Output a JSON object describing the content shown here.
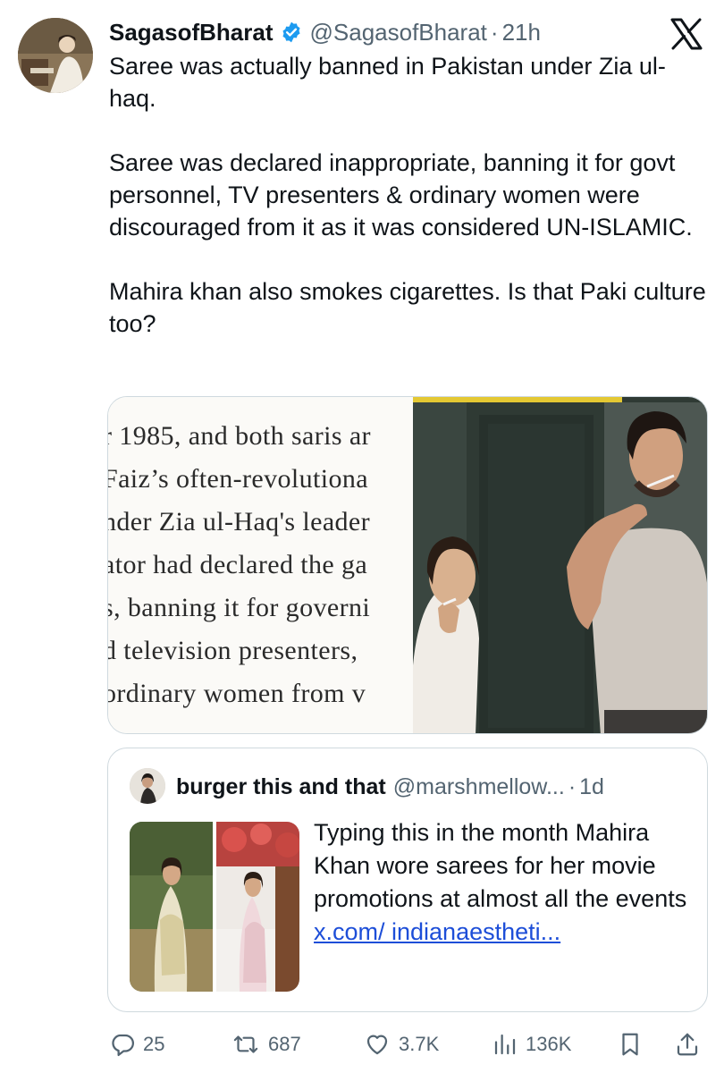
{
  "tweet": {
    "author": {
      "display_name": "SagasofBharat",
      "handle": "@SagasofBharat",
      "verified": true
    },
    "time": "21h",
    "separator": "·",
    "text_paragraphs": [
      "Saree was actually banned in Pakistan under Zia ul-haq.",
      "Saree was declared inappropriate, banning it for govt personnel, TV presenters & ordinary women were discouraged from it as it was considered UN-ISLAMIC.",
      "Mahira khan also smokes cigarettes. Is that Paki culture too?"
    ],
    "media": {
      "article_lines": [
        "r 1985, and both saris ar",
        "Faiz’s often-revolutiona",
        "nder Zia ul-Haq's leader",
        "ator had declared the ga",
        "s, banning it for governi",
        "d television presenters,",
        "ordinary women from v"
      ]
    }
  },
  "quoted_tweet": {
    "display_name": "burger this and that",
    "handle": "@marshmellow...",
    "separator": "·",
    "time": "1d",
    "text": "Typing this in the month Mahira Khan wore sarees for her movie promotions at almost all the events",
    "link": "x.com/ indianaestheti..."
  },
  "actions": {
    "replies": "25",
    "reposts": "687",
    "likes": "3.7K",
    "views": "136K"
  },
  "icons": {
    "logo": "x-logo-icon",
    "verified": "verified-badge-icon",
    "reply": "reply-icon",
    "repost": "repost-icon",
    "like": "heart-icon",
    "views": "views-icon",
    "bookmark": "bookmark-icon",
    "share": "share-icon"
  },
  "colors": {
    "verified_blue": "#1d9bf0",
    "muted_text": "#536471",
    "link": "#1d4ed8",
    "border": "#cfd9de"
  }
}
